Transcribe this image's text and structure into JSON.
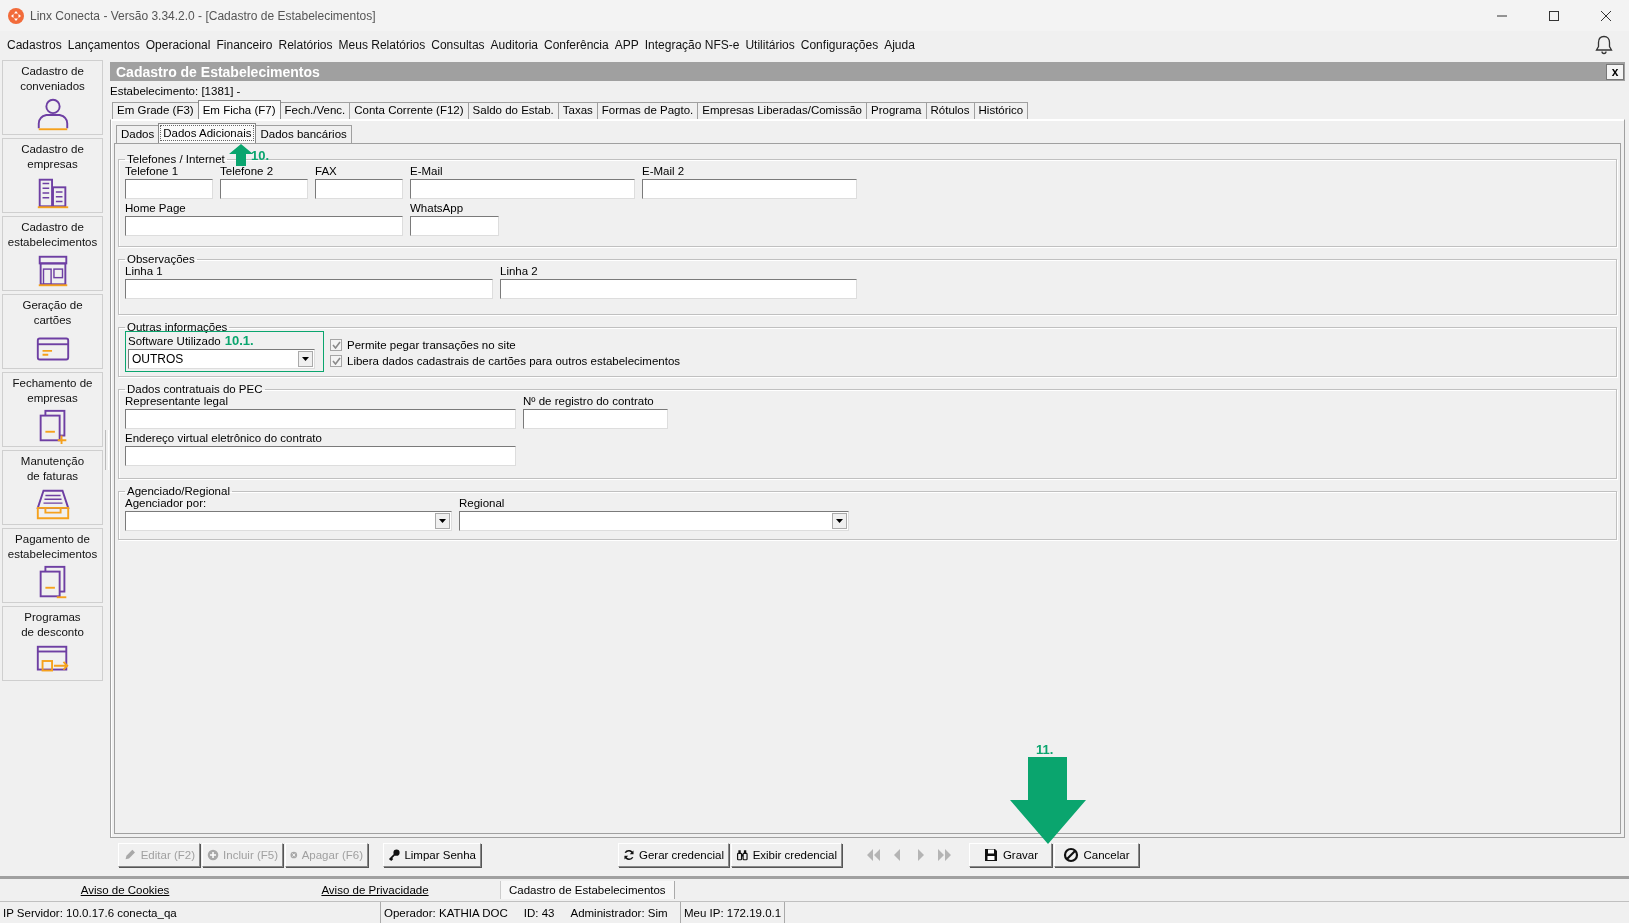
{
  "window": {
    "title": "Linx Conecta - Versão 3.34.2.0 - [Cadastro de Estabelecimentos]"
  },
  "menu": [
    "Cadastros",
    "Lançamentos",
    "Operacional",
    "Financeiro",
    "Relatórios",
    "Meus Relatórios",
    "Consultas",
    "Auditoria",
    "Conferência",
    "APP",
    "Integração NFS-e",
    "Utilitários",
    "Configurações",
    "Ajuda"
  ],
  "sidebar": {
    "items": [
      {
        "label": "Cadastro de\nconveniados"
      },
      {
        "label": "Cadastro de\nempresas"
      },
      {
        "label": "Cadastro de\nestabelecimentos"
      },
      {
        "label": "Geração de\ncartões"
      },
      {
        "label": "Fechamento de\nempresas"
      },
      {
        "label": "Manutenção\nde faturas"
      },
      {
        "label": "Pagamento de\nestabelecimentos"
      },
      {
        "label": "Programas\nde desconto"
      }
    ]
  },
  "module": {
    "title": "Cadastro de Estabelecimentos",
    "close": "x",
    "record": "Estabelecimento: [1381] -"
  },
  "tabs": [
    {
      "label": "Em Grade (F3)",
      "selected": false
    },
    {
      "label": "Em Ficha (F7)",
      "selected": true
    },
    {
      "label": "Fech./Venc.",
      "selected": false
    },
    {
      "label": "Conta Corrente (F12)",
      "selected": false
    },
    {
      "label": "Saldo do Estab.",
      "selected": false
    },
    {
      "label": "Taxas",
      "selected": false
    },
    {
      "label": "Formas de Pagto.",
      "selected": false
    },
    {
      "label": "Empresas Liberadas/Comissão",
      "selected": false
    },
    {
      "label": "Programa",
      "selected": false
    },
    {
      "label": "Rótulos",
      "selected": false
    },
    {
      "label": "Histórico",
      "selected": false
    }
  ],
  "subtabs": [
    {
      "label": "Dados",
      "selected": false
    },
    {
      "label": "Dados Adicionais",
      "selected": true
    },
    {
      "label": "Dados bancários",
      "selected": false
    }
  ],
  "groups": [
    {
      "title": "Telefones / Internet",
      "kind": "fields",
      "fields": [
        {
          "label": "Telefone 1",
          "kind": "text"
        },
        {
          "label": "Telefone 2",
          "kind": "text"
        },
        {
          "label": "FAX",
          "kind": "text"
        },
        {
          "label": "E-Mail",
          "kind": "text"
        },
        {
          "label": "E-Mail 2",
          "kind": "text"
        },
        {
          "label": "Home Page",
          "kind": "text"
        },
        {
          "label": "WhatsApp",
          "kind": "text"
        }
      ]
    },
    {
      "title": "Observações",
      "kind": "fields",
      "fields": [
        {
          "label": "Linha 1",
          "kind": "text"
        },
        {
          "label": "Linha 2",
          "kind": "text"
        }
      ]
    },
    {
      "title": "Outras informações",
      "kind": "options",
      "field": {
        "label": "Software Utilizado",
        "note": "10.1.",
        "value": "OUTROS",
        "highlighted": true
      },
      "checkboxes": [
        {
          "label": "Permite pegar transações no site",
          "checked": true
        },
        {
          "label": "Libera dados cadastrais de cartões para outros estabelecimentos",
          "checked": true
        }
      ]
    },
    {
      "title": "Dados contratuais do PEC",
      "kind": "fields",
      "fields": [
        {
          "label": "Representante legal",
          "kind": "text"
        },
        {
          "label": "Nº de registro do contrato",
          "kind": "text"
        },
        {
          "label": "Endereço virtual eletrônico do contrato",
          "kind": "text"
        }
      ]
    },
    {
      "title": "Agenciado/Regional",
      "kind": "fields",
      "fields": [
        {
          "label": "Agenciador por:",
          "kind": "select"
        },
        {
          "label": "Regional",
          "kind": "select"
        }
      ]
    }
  ],
  "toolbar": {
    "left": [
      {
        "label": "Editar (F2)",
        "disabled": true
      },
      {
        "label": "Incluir (F5)",
        "disabled": true
      },
      {
        "label": "Apagar (F6)",
        "disabled": true
      },
      {
        "label": "Limpar Senha",
        "disabled": false
      }
    ],
    "middle": [
      {
        "label": "Gerar credencial",
        "disabled": false
      },
      {
        "label": "Exibir credencial",
        "disabled": false
      }
    ],
    "navigation": [
      {
        "disabled": true
      },
      {
        "disabled": true
      },
      {
        "disabled": true
      },
      {
        "disabled": true
      }
    ],
    "right": [
      {
        "label": "Gravar",
        "disabled": false
      },
      {
        "label": "Cancelar",
        "disabled": false
      }
    ]
  },
  "annotations": [
    {
      "kind": "arrow-up",
      "label": "10."
    },
    {
      "kind": "arrow-down",
      "label": "11."
    }
  ],
  "footer": {
    "links": [
      "Aviso de Cookies",
      "Aviso de Privacidade"
    ],
    "windows": [
      {
        "label": "Cadastro de Estabelecimentos",
        "selected": true
      }
    ]
  },
  "status_bar": [
    {
      "items": [
        "IP Servidor: 10.0.17.6 conecta_qa"
      ]
    },
    {
      "items": [
        "Operador: KATHIA DOC",
        "ID: 43",
        "Administrador: Sim"
      ]
    },
    {
      "items": [
        "Meu IP: 172.19.0.1"
      ]
    }
  ]
}
